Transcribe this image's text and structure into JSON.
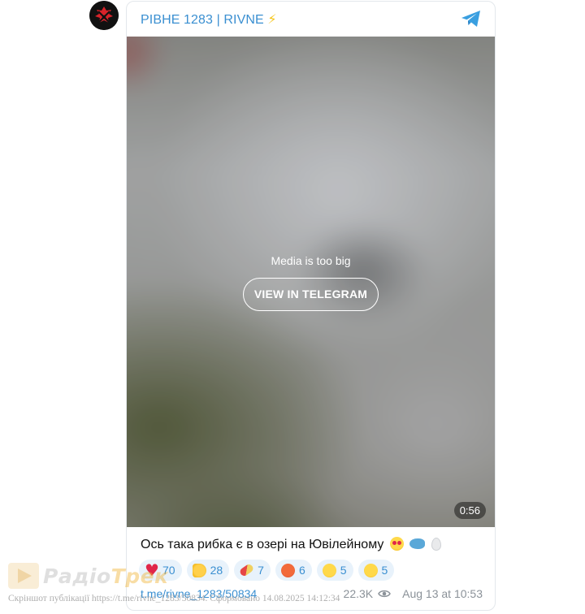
{
  "channel": {
    "title": "РІВНЕ 1283 | RIVNE",
    "title_suffix_icon": "lightning-icon",
    "avatar_icon": "channel-emblem-icon",
    "share_icon": "telegram-icon"
  },
  "media": {
    "message": "Media is too big",
    "button_label": "VIEW IN TELEGRAM",
    "duration": "0:56"
  },
  "post": {
    "caption": "Ось така рибка є в озері на Ювілейному",
    "caption_emojis": [
      "heart-eyes-emoji",
      "fish-emoji",
      "pin-emoji"
    ],
    "reactions": [
      {
        "icon": "heart-emoji",
        "count": "70"
      },
      {
        "icon": "thumbs-up-emoji",
        "count": "28"
      },
      {
        "icon": "pill-emoji",
        "count": "7"
      },
      {
        "icon": "angry-face-emoji",
        "count": "6"
      },
      {
        "icon": "grinning-face-emoji",
        "count": "5"
      },
      {
        "icon": "sad-face-emoji",
        "count": "5"
      }
    ],
    "link": "t.me/rivne_1283/50834",
    "views": "22.3K",
    "date": "Aug 13 at 10:53"
  },
  "watermark": {
    "logo_text_a": "Радіо",
    "logo_text_b": "Трек",
    "note": "Скріншот публікації https://t.me/rivne_1283/50834. Сформовано 14.08.2025 14:12:34"
  },
  "colors": {
    "accent": "#3a8fd1",
    "reaction_bg": "#e8f2fb",
    "meta_gray": "#8b9299"
  }
}
